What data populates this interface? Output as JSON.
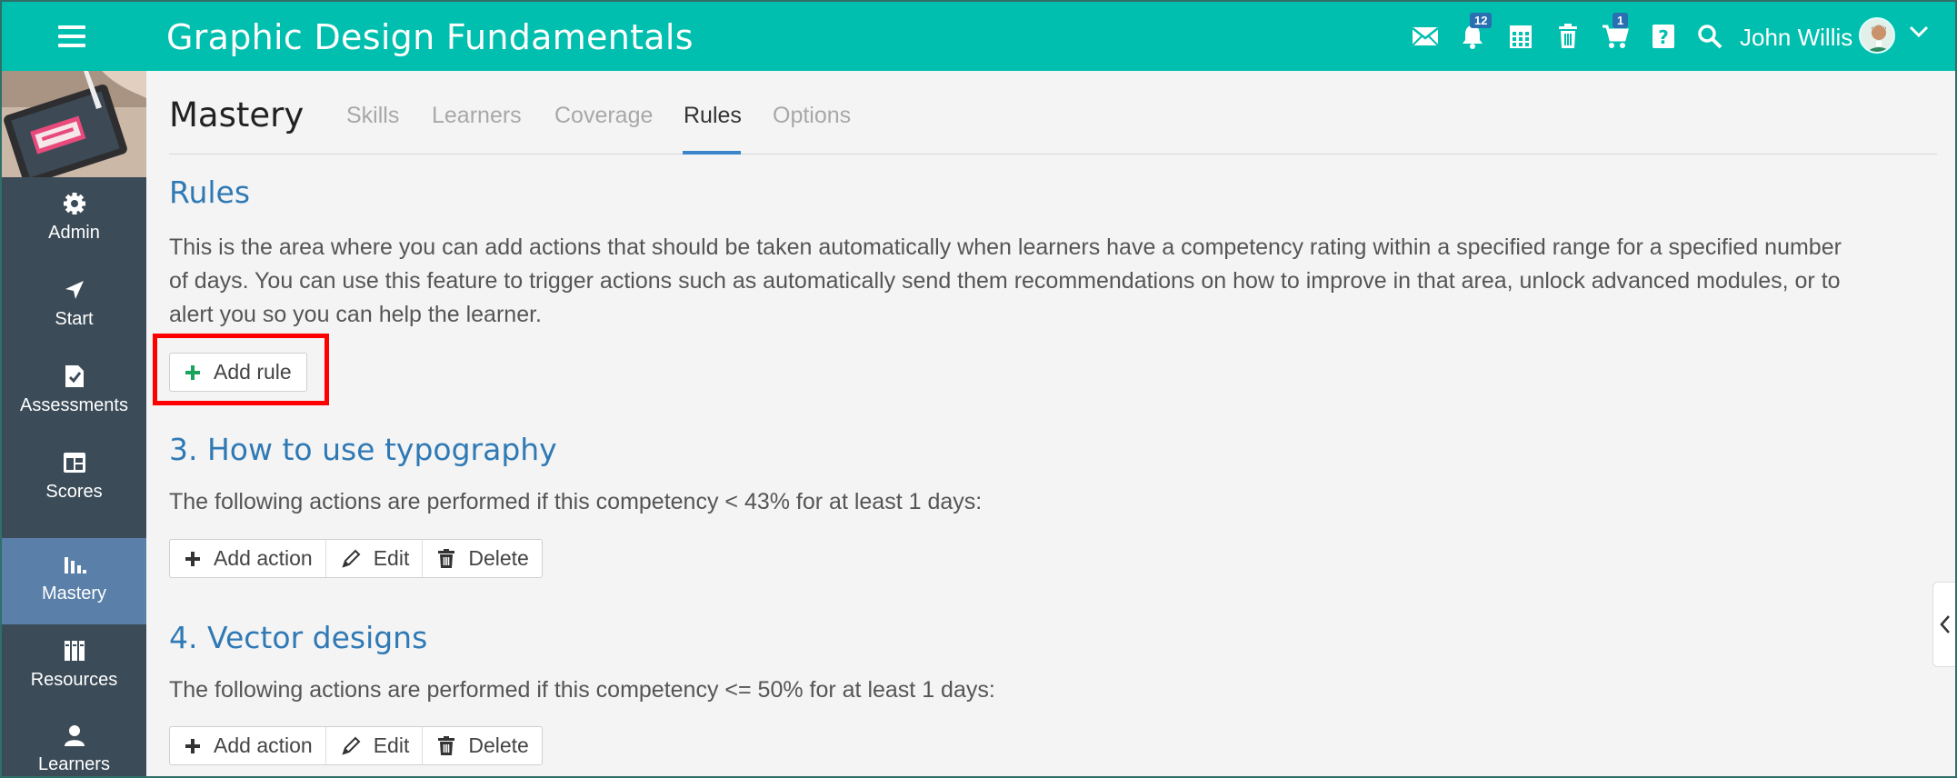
{
  "header": {
    "title": "Graphic Design Fundamentals",
    "notifications_badge": "12",
    "cart_badge": "1",
    "user_name": "John Willis"
  },
  "sidebar": {
    "items": [
      {
        "label": "Admin",
        "icon": "gear-icon"
      },
      {
        "label": "Start",
        "icon": "navigation-arrow-icon"
      },
      {
        "label": "Assessments",
        "icon": "checklist-icon"
      },
      {
        "label": "Scores",
        "icon": "table-icon"
      },
      {
        "label": "Mastery",
        "icon": "bar-chart-icon",
        "active": true
      },
      {
        "label": "Resources",
        "icon": "books-icon"
      },
      {
        "label": "Learners",
        "icon": "user-icon"
      }
    ]
  },
  "main": {
    "page_title": "Mastery",
    "tabs": [
      {
        "label": "Skills"
      },
      {
        "label": "Learners"
      },
      {
        "label": "Coverage"
      },
      {
        "label": "Rules",
        "active": true
      },
      {
        "label": "Options"
      }
    ],
    "rules_heading": "Rules",
    "rules_description_lines": [
      "This is the area where you can add actions that should be taken automatically when learners have a competency rating within a specified range for a specified number",
      "of days. You can use this feature to trigger actions such as automatically send them recommendations on how to improve in that area, unlock advanced modules, or to",
      "alert you so you can help the learner."
    ],
    "add_rule_label": "Add rule",
    "competencies": [
      {
        "heading": "3. How to use typography",
        "condition": "The following actions are performed if this competency < 43% for at least 1 days:",
        "add_action_label": "Add action",
        "edit_label": "Edit",
        "delete_label": "Delete"
      },
      {
        "heading": "4. Vector designs",
        "condition": "The following actions are performed if this competency <= 50% for at least 1 days:",
        "add_action_label": "Add action",
        "edit_label": "Edit",
        "delete_label": "Delete"
      }
    ]
  },
  "colors": {
    "topbar": "#00bfae",
    "sidebar": "#3b4b57",
    "sidebar_active": "#5a7fa8",
    "heading_blue": "#2f79b5",
    "tab_underline": "#3a86c8",
    "plus_green": "#1aa35a",
    "highlight_red": "#ff0000"
  }
}
